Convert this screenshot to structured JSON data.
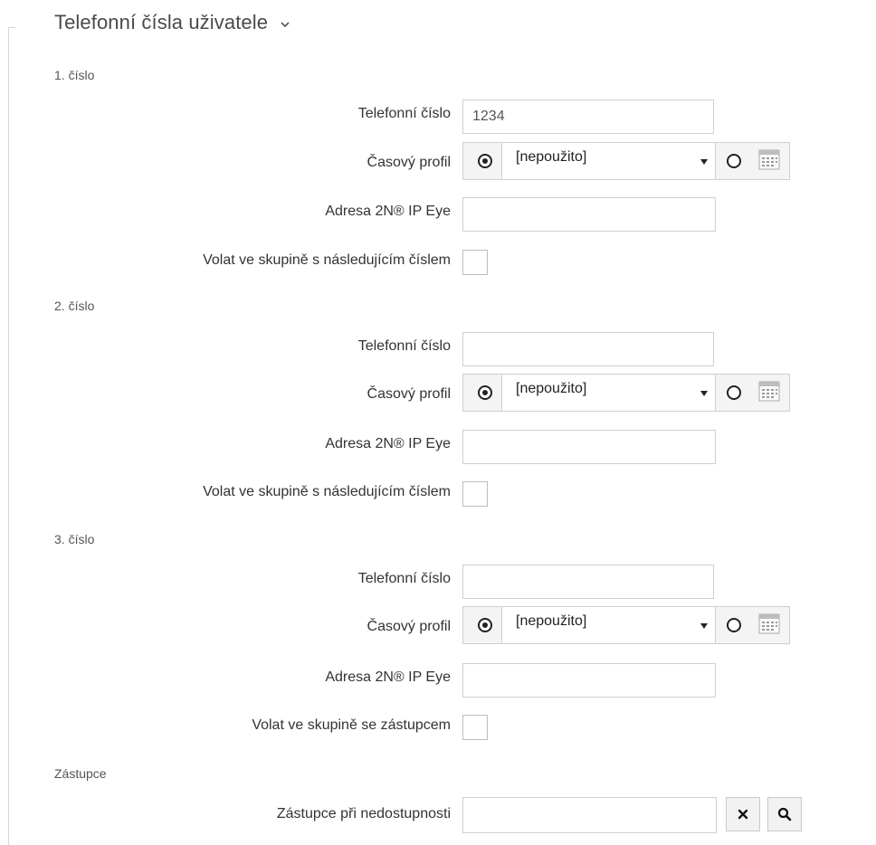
{
  "section": {
    "title": "Telefonní čísla uživatele"
  },
  "numbers": [
    {
      "heading": "1. číslo",
      "phone_label": "Telefonní číslo",
      "phone_value": "1234",
      "profile_label": "Časový profil",
      "profile_value": "[nepoužito]",
      "eye_label": "Adresa 2N® IP Eye",
      "eye_value": "",
      "group_label": "Volat ve skupině s následujícím číslem"
    },
    {
      "heading": "2. číslo",
      "phone_label": "Telefonní číslo",
      "phone_value": "",
      "profile_label": "Časový profil",
      "profile_value": "[nepoužito]",
      "eye_label": "Adresa 2N® IP Eye",
      "eye_value": "",
      "group_label": "Volat ve skupině s následujícím číslem"
    },
    {
      "heading": "3. číslo",
      "phone_label": "Telefonní číslo",
      "phone_value": "",
      "profile_label": "Časový profil",
      "profile_value": "[nepoužito]",
      "eye_label": "Adresa 2N® IP Eye",
      "eye_value": "",
      "group_label": "Volat ve skupině se zástupcem"
    }
  ],
  "deputy": {
    "heading": "Zástupce",
    "label": "Zástupce při nedostupnosti",
    "value": ""
  },
  "icons": {
    "collapse": "chevron-down-icon",
    "calendar": "calendar-icon",
    "clear": "close-icon",
    "search": "search-icon"
  }
}
